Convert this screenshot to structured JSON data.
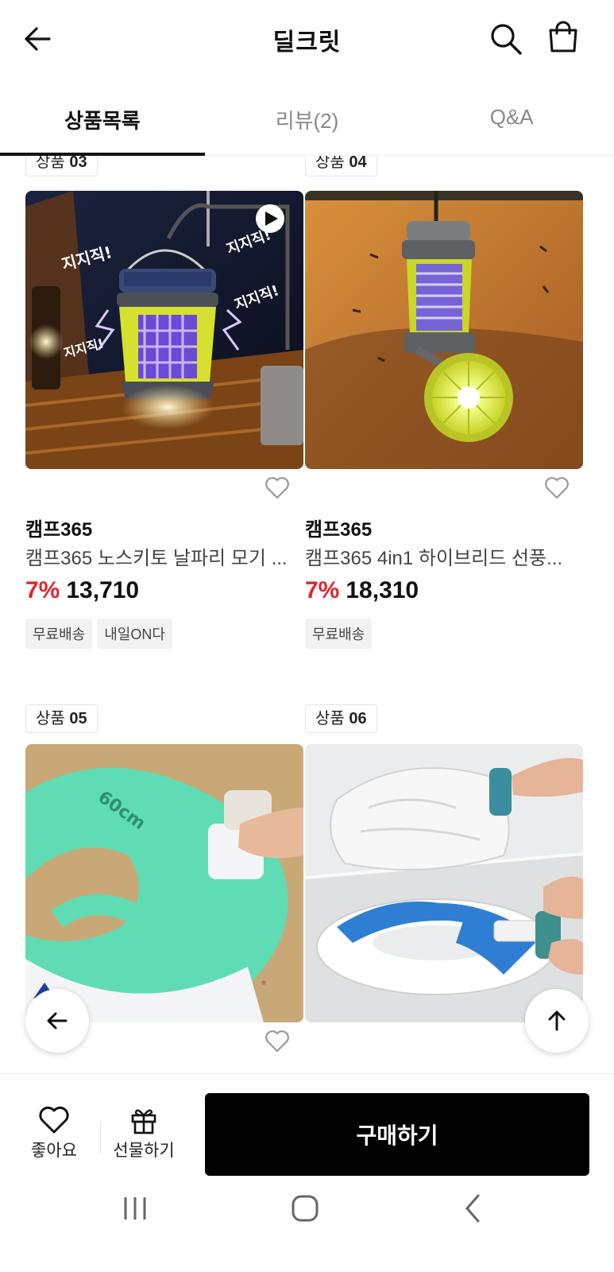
{
  "header": {
    "title": "딜크릿"
  },
  "tabs": [
    {
      "label": "상품목록",
      "active": true
    },
    {
      "label": "리뷰(2)",
      "active": false
    },
    {
      "label": "Q&A",
      "active": false
    }
  ],
  "products": [
    {
      "badge_prefix": "상품",
      "badge_num": "03",
      "brand": "캠프365",
      "name": "캠프365 노스키토 날파리 모기 ...",
      "discount": "7%",
      "price": "13,710",
      "tags": [
        "무료배송",
        "내일ON다"
      ],
      "has_video": true
    },
    {
      "badge_prefix": "상품",
      "badge_num": "04",
      "brand": "캠프365",
      "name": "캠프365 4in1 하이브리드 선풍...",
      "discount": "7%",
      "price": "18,310",
      "tags": [
        "무료배송"
      ],
      "has_video": false
    },
    {
      "badge_prefix": "상품",
      "badge_num": "05"
    },
    {
      "badge_prefix": "상품",
      "badge_num": "06"
    }
  ],
  "bottom_bar": {
    "like_label": "좋아요",
    "gift_label": "선물하기",
    "buy_label": "구매하기"
  },
  "colors": {
    "discount": "#e0262e",
    "buy_button": "#000000"
  }
}
